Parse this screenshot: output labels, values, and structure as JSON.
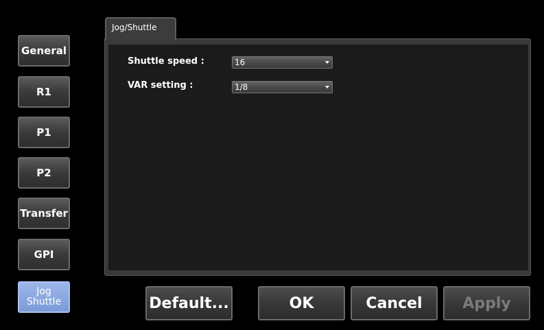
{
  "sidebar": {
    "items": [
      {
        "label": "General"
      },
      {
        "label": "R1"
      },
      {
        "label": "P1"
      },
      {
        "label": "P2"
      },
      {
        "label": "Transfer"
      },
      {
        "label": "GPI"
      },
      {
        "label_line1": "Jog",
        "label_line2": "Shuttle",
        "active": true
      }
    ]
  },
  "tab": {
    "label": "Jog/Shuttle"
  },
  "settings": {
    "shuttle_speed": {
      "label": "Shuttle speed :",
      "value": "16"
    },
    "var_setting": {
      "label": "VAR setting :",
      "value": "1/8"
    }
  },
  "buttons": {
    "default_label": "Default...",
    "ok_label": "OK",
    "cancel_label": "Cancel",
    "apply_label": "Apply"
  },
  "colors": {
    "active_tab": "#8aa8e0",
    "panel_bg": "#1b1b1b",
    "disabled_text": "#7a7a7a"
  }
}
